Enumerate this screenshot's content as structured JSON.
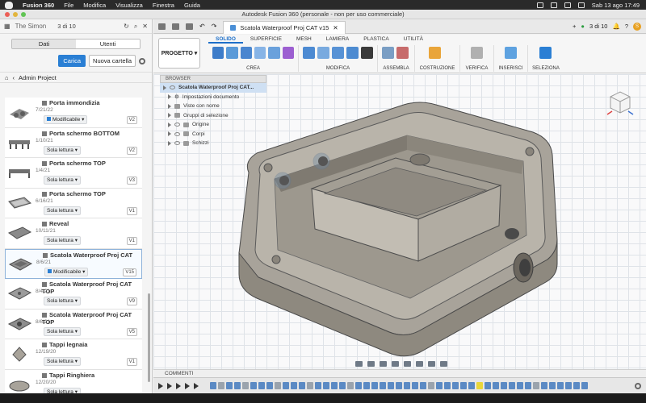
{
  "menubar": {
    "app": "Fusion 360",
    "items": [
      "File",
      "Modifica",
      "Visualizza",
      "Finestra",
      "Guida"
    ],
    "datetime": "Sab 13 ago  17:49"
  },
  "window": {
    "title": "Autodesk Fusion 360 (personale - non per uso commerciale)"
  },
  "data_panel": {
    "user": "The Simon",
    "pager": "3 di 10",
    "tabs": [
      "Dati",
      "Utenti"
    ],
    "upload_label": "Carica",
    "new_folder_label": "Nuova cartella",
    "breadcrumb": "Admin Project",
    "items": [
      {
        "name": "Porta immondizia",
        "date": "7/21/22",
        "status": "Modificabile",
        "version": "V2"
      },
      {
        "name": "Porta schermo BOTTOM",
        "date": "1/10/21",
        "status": "Sola lettura",
        "version": "V2"
      },
      {
        "name": "Porta schermo TOP",
        "date": "1/4/21",
        "status": "Sola lettura",
        "version": "V3"
      },
      {
        "name": "Porta schermo TOP",
        "date": "6/16/21",
        "status": "Sola lettura",
        "version": "V1"
      },
      {
        "name": "Reveal",
        "date": "10/11/21",
        "status": "Sola lettura",
        "version": "V1"
      },
      {
        "name": "Scatola Waterproof Proj CAT",
        "date": "8/6/21",
        "status": "Modificabile",
        "version": "V15"
      },
      {
        "name": "Scatola Waterproof Proj CAT TOP",
        "date": "8/4/21",
        "status": "Sola lettura",
        "version": "V9"
      },
      {
        "name": "Scatola Waterproof Proj CAT TOP",
        "date": "8/6/21",
        "status": "Sola lettura",
        "version": "V5"
      },
      {
        "name": "Tappi legnaia",
        "date": "12/19/20",
        "status": "Sola lettura",
        "version": "V1"
      },
      {
        "name": "Tappi Ringhiera",
        "date": "12/20/20",
        "status": "Sola lettura",
        "version": ""
      }
    ]
  },
  "tabstrip": {
    "doc_title": "Scatola Waterproof Proj CAT v15",
    "pager": "3 di 10"
  },
  "ribbon": {
    "project_label": "PROGETTO",
    "tabs": [
      "SOLIDO",
      "SUPERFICIE",
      "MESH",
      "LAMIERA",
      "PLASTICA",
      "UTILITÀ"
    ],
    "active_tab": "SOLIDO",
    "groups": [
      "CREA",
      "MODIFICA",
      "ASSEMBLA",
      "COSTRUZIONE",
      "VERIFICA",
      "INSERISCI",
      "SELEZIONA"
    ]
  },
  "browser": {
    "header": "BROWSER",
    "root": "Scatola Waterproof Proj CAT...",
    "nodes": [
      "Impostazioni documento",
      "Viste con nome",
      "Gruppi di selezione",
      "Origine",
      "Corpi",
      "Schizzi"
    ]
  },
  "comments_label": "COMMENTI",
  "colors": {
    "accent": "#2a7fd4",
    "model": "#a8a39a",
    "highlight_timeline": "#e9d73b"
  }
}
